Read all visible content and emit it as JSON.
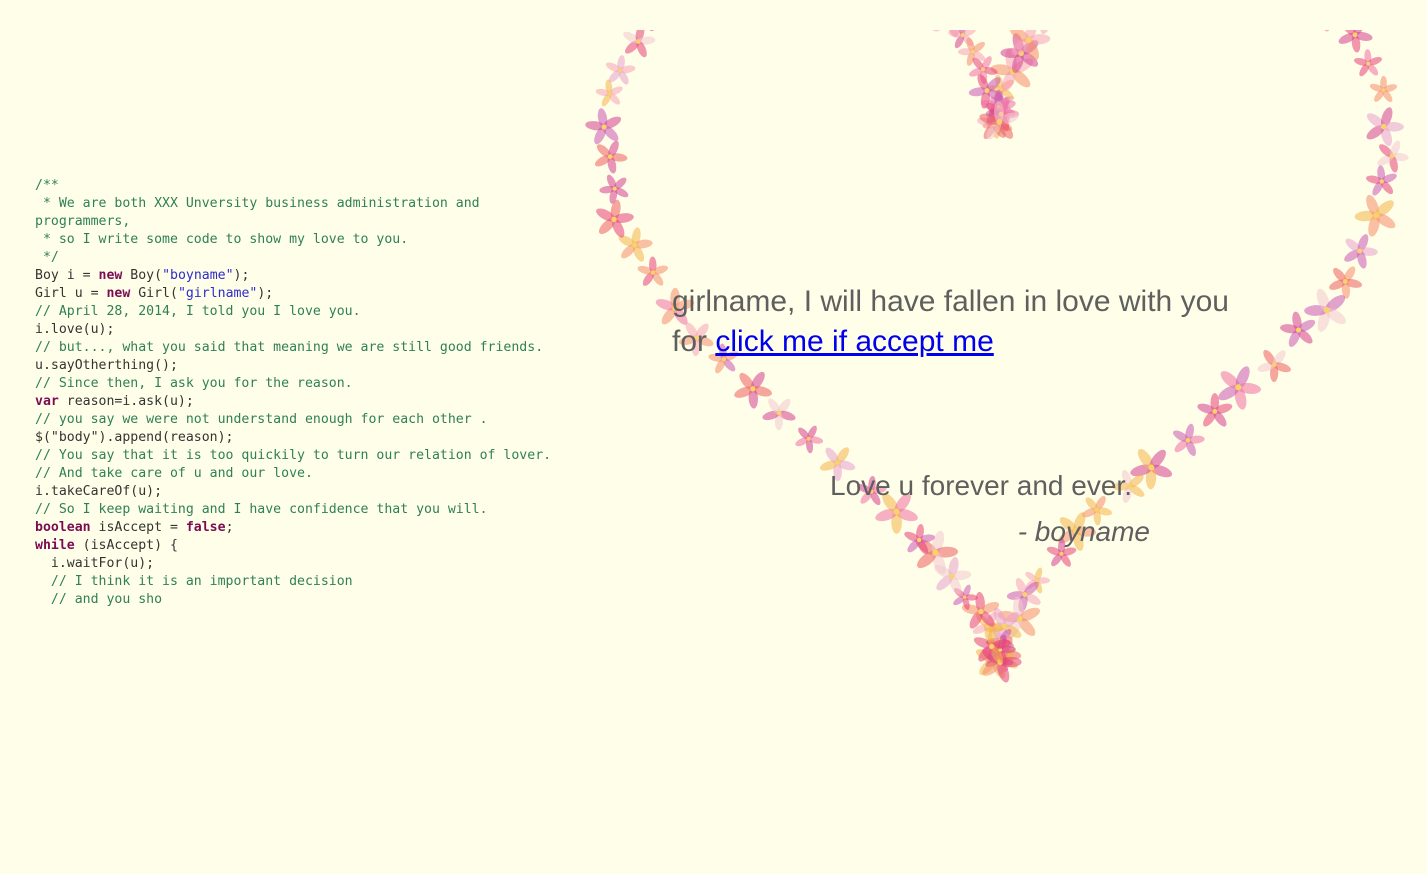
{
  "code": {
    "lines": [
      [
        [
          "comment",
          "/**"
        ]
      ],
      [
        [
          "comment",
          " * We are both XXX Unversity business administration and"
        ]
      ],
      [
        [
          "comment",
          "programmers,"
        ]
      ],
      [
        [
          "comment",
          " * so I write some code to show my love to you."
        ]
      ],
      [
        [
          "comment",
          " */"
        ]
      ],
      [
        [
          "plain",
          "Boy i = "
        ],
        [
          "kw",
          "new"
        ],
        [
          "plain",
          " Boy("
        ],
        [
          "str",
          "\"boyname\""
        ],
        [
          "plain",
          ");"
        ]
      ],
      [
        [
          "plain",
          "Girl u = "
        ],
        [
          "kw",
          "new"
        ],
        [
          "plain",
          " Girl("
        ],
        [
          "str",
          "\"girlname\""
        ],
        [
          "plain",
          ");"
        ]
      ],
      [
        [
          "comment",
          "// April 28, 2014, I told you I love you."
        ]
      ],
      [
        [
          "plain",
          "i.love(u);"
        ]
      ],
      [
        [
          "comment",
          "// but..., what you said that meaning we are still good friends."
        ]
      ],
      [
        [
          "plain",
          "u.sayOtherthing();"
        ]
      ],
      [
        [
          "comment",
          "// Since then, I ask you for the reason."
        ]
      ],
      [
        [
          "kw",
          "var"
        ],
        [
          "plain",
          " reason=i.ask(u);"
        ]
      ],
      [
        [
          "comment",
          "// you say we were not understand enough for each other ."
        ]
      ],
      [
        [
          "plain",
          "$(\"body\").append(reason);"
        ]
      ],
      [
        [
          "comment",
          "// You say that it is too quickily to turn our relation of lover."
        ]
      ],
      [
        [
          "comment",
          "// And take care of u and our love."
        ]
      ],
      [
        [
          "plain",
          "i.takeCareOf(u);"
        ]
      ],
      [
        [
          "comment",
          "// So I keep waiting and I have confidence that you will."
        ]
      ],
      [
        [
          "kw",
          "boolean"
        ],
        [
          "plain",
          " isAccept = "
        ],
        [
          "kw",
          "false"
        ],
        [
          "plain",
          ";"
        ]
      ],
      [
        [
          "kw",
          "while"
        ],
        [
          "plain",
          " (isAccept) {"
        ]
      ],
      [
        [
          "plain",
          "  i.waitFor(u);"
        ]
      ],
      [
        [
          "comment",
          "  // I think it is an important decision"
        ]
      ],
      [
        [
          "comment",
          "  // and you sho"
        ]
      ]
    ]
  },
  "message": {
    "line1": "girlname, I will have fallen in love with you",
    "line2_prefix": "for ",
    "link": "click me if accept me"
  },
  "closing": "Love u forever and ever.",
  "signature": "- boyname",
  "heart": {
    "flower_colors": [
      "#e83f7a",
      "#f06fa0",
      "#f7a3b8",
      "#d4408f",
      "#f58c6a",
      "#f4b24a",
      "#c955b3",
      "#ec5f5f",
      "#f2c6cf",
      "#e8a0d0"
    ]
  }
}
